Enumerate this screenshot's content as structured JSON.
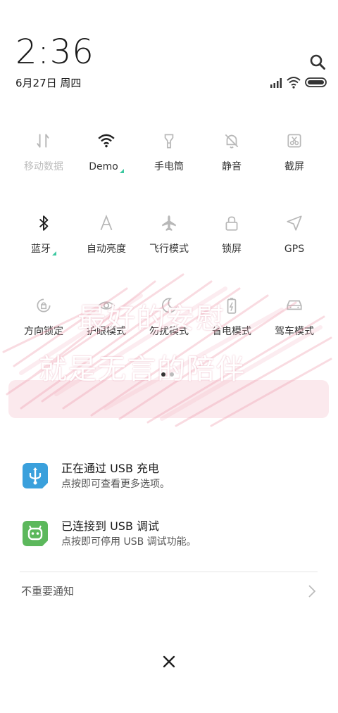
{
  "header": {
    "time": "2:36",
    "date": "6月27日 周四"
  },
  "toggles": [
    {
      "label": "移动数据",
      "icon": "mobile-data-icon",
      "active": false
    },
    {
      "label": "Demo",
      "icon": "wifi-icon",
      "active": true,
      "has_more": true
    },
    {
      "label": "手电筒",
      "icon": "flashlight-icon",
      "active": true
    },
    {
      "label": "静音",
      "icon": "mute-bell-icon",
      "active": true
    },
    {
      "label": "截屏",
      "icon": "screenshot-icon",
      "active": true
    },
    {
      "label": "蓝牙",
      "icon": "bluetooth-icon",
      "active": true,
      "has_more": true
    },
    {
      "label": "自动亮度",
      "icon": "auto-brightness-icon",
      "active": true
    },
    {
      "label": "飞行模式",
      "icon": "airplane-icon",
      "active": true
    },
    {
      "label": "锁屏",
      "icon": "lock-icon",
      "active": true
    },
    {
      "label": "GPS",
      "icon": "location-icon",
      "active": true
    },
    {
      "label": "方向锁定",
      "icon": "rotation-lock-icon",
      "active": true
    },
    {
      "label": "护眼模式",
      "icon": "eye-icon",
      "active": true
    },
    {
      "label": "勿扰模式",
      "icon": "moon-icon",
      "active": true
    },
    {
      "label": "省电模式",
      "icon": "battery-saver-icon",
      "active": true
    },
    {
      "label": "驾车模式",
      "icon": "car-icon",
      "active": true
    }
  ],
  "banner": {
    "line1": "最好的安慰",
    "line2": "就是无言的陪伴"
  },
  "pager": {
    "current": 1,
    "total": 2
  },
  "notifications": [
    {
      "title": "正在通过 USB 充电",
      "subtitle": "点按即可查看更多选项。",
      "icon": "usb-icon",
      "color": "#3aa0dc"
    },
    {
      "title": "已连接到 USB 调试",
      "subtitle": "点按即可停用 USB 调试功能。",
      "icon": "android-icon",
      "color": "#5cb85c"
    }
  ],
  "unimportant_label": "不重要通知",
  "colors": {
    "accent": "#3cc8a0",
    "inactive": "#bdbdbd",
    "active": "#222222"
  }
}
